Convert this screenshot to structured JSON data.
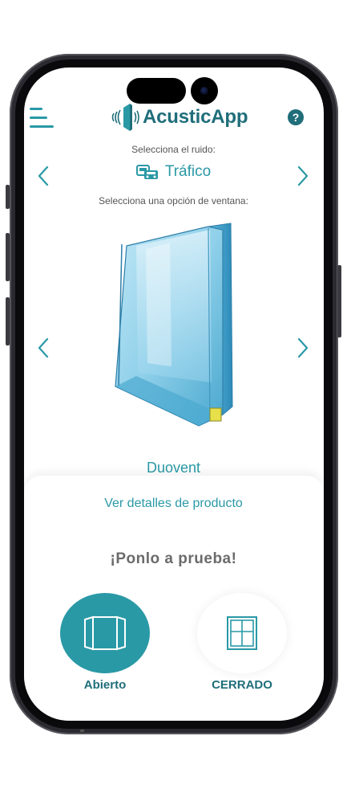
{
  "app": {
    "name": "AcusticApp",
    "accent_color": "#2a99a6",
    "brand_dark": "#1f6e7a"
  },
  "header": {
    "menu_icon": "hamburger-menu-icon",
    "logo_icon": "window-sound-waves-icon",
    "help_label": "?"
  },
  "noise": {
    "prompt": "Selecciona el ruido:",
    "selected": "Tráfico",
    "icon": "traffic-cars-icon"
  },
  "window": {
    "prompt": "Selecciona una opción de ventana:",
    "selected_product": "Duovent"
  },
  "sheet": {
    "details_link": "Ver detalles de producto",
    "try_title": "¡Ponlo a prueba!",
    "options": [
      {
        "label": "Abierto",
        "icon": "open-window-icon",
        "active": true
      },
      {
        "label": "CERRADO",
        "icon": "closed-window-icon",
        "active": false
      }
    ]
  }
}
